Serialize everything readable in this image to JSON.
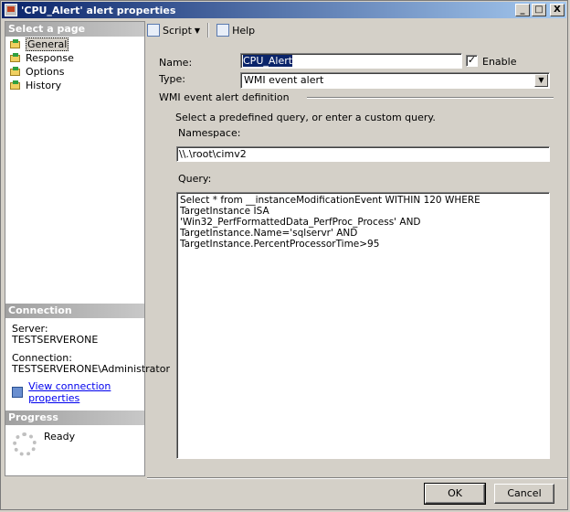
{
  "window": {
    "title": "'CPU_Alert' alert properties",
    "min": "_",
    "max": "□",
    "close": "X"
  },
  "left": {
    "select_page_header": "Select a page",
    "pages": [
      {
        "label": "General"
      },
      {
        "label": "Response"
      },
      {
        "label": "Options"
      },
      {
        "label": "History"
      }
    ],
    "connection_header": "Connection",
    "server_label": "Server:",
    "server_value": "TESTSERVERONE",
    "connection_label": "Connection:",
    "connection_value": "TESTSERVERONE\\Administrator",
    "view_link": "View connection properties",
    "progress_header": "Progress",
    "progress_status": "Ready"
  },
  "toolbar": {
    "script": "Script",
    "help": "Help"
  },
  "form": {
    "name_label": "Name:",
    "name_value": "CPU_Alert",
    "enable_label": "Enable",
    "enable_checked": true,
    "type_label": "Type:",
    "type_value": "WMI event alert",
    "group_title": "WMI event alert definition",
    "instructions": "Select a predefined query, or enter a custom query.",
    "namespace_label": "Namespace:",
    "namespace_value": "\\\\.\\root\\cimv2",
    "query_label": "Query:",
    "query_value": "Select * from __instanceModificationEvent WITHIN 120 WHERE TargetInstance ISA\n'Win32_PerfFormattedData_PerfProc_Process' AND TargetInstance.Name='sqlservr' AND\nTargetInstance.PercentProcessorTime>95"
  },
  "buttons": {
    "ok": "OK",
    "cancel": "Cancel"
  }
}
